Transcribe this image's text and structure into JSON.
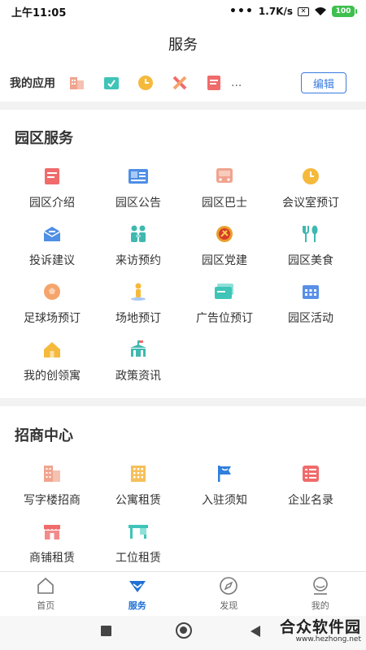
{
  "status_bar": {
    "time": "上午11:05",
    "dots": "•••",
    "speed": "1.7K/s",
    "battery": "100"
  },
  "header": {
    "title": "服务"
  },
  "my_apps": {
    "label": "我的应用",
    "icons": [
      "building-icon",
      "check-icon",
      "clock-icon",
      "tools-icon",
      "note-icon"
    ],
    "more": "...",
    "edit_label": "编辑"
  },
  "park_services": {
    "title": "园区服务",
    "items": [
      {
        "label": "园区介绍",
        "icon": "intro-icon",
        "color": "#f06b6b"
      },
      {
        "label": "园区公告",
        "icon": "notice-icon",
        "color": "#4f8fe6"
      },
      {
        "label": "园区巴士",
        "icon": "bus-icon",
        "color": "#f0a48f"
      },
      {
        "label": "会议室预订",
        "icon": "meeting-clock-icon",
        "color": "#f5b93b"
      },
      {
        "label": "投诉建议",
        "icon": "mail-icon",
        "color": "#4f8fe6"
      },
      {
        "label": "来访预约",
        "icon": "visitors-icon",
        "color": "#3fb8b0"
      },
      {
        "label": "园区党建",
        "icon": "party-icon",
        "color": "#e8a12c"
      },
      {
        "label": "园区美食",
        "icon": "food-icon",
        "color": "#3fb8b0"
      },
      {
        "label": "足球场预订",
        "icon": "football-icon",
        "color": "#f5a56b"
      },
      {
        "label": "场地预订",
        "icon": "venue-icon",
        "color": "#f5b93b"
      },
      {
        "label": "广告位预订",
        "icon": "ad-card-icon",
        "color": "#3fc4b8"
      },
      {
        "label": "园区活动",
        "icon": "calendar-icon",
        "color": "#5a8fe8"
      },
      {
        "label": "我的创领寓",
        "icon": "house-icon",
        "color": "#f5b93b"
      },
      {
        "label": "政策资讯",
        "icon": "policy-icon",
        "color": "#3fb8b0"
      }
    ]
  },
  "investment_center": {
    "title": "招商中心",
    "items": [
      {
        "label": "写字楼招商",
        "icon": "office-building-icon",
        "color": "#f0a48f"
      },
      {
        "label": "公寓租赁",
        "icon": "apartment-icon",
        "color": "#f5c05a"
      },
      {
        "label": "入驻须知",
        "icon": "flag-icon",
        "color": "#2f7fdc"
      },
      {
        "label": "企业名录",
        "icon": "directory-icon",
        "color": "#f06b6b"
      },
      {
        "label": "商铺租赁",
        "icon": "shop-icon",
        "color": "#f06b6b"
      },
      {
        "label": "工位租赁",
        "icon": "desk-icon",
        "color": "#3fc4b8"
      }
    ]
  },
  "tabbar": {
    "items": [
      {
        "label": "首页",
        "icon": "home-icon",
        "active": false
      },
      {
        "label": "服务",
        "icon": "service-icon",
        "active": true
      },
      {
        "label": "发现",
        "icon": "compass-icon",
        "active": false
      },
      {
        "label": "我的",
        "icon": "profile-icon",
        "active": false
      }
    ]
  },
  "watermark": {
    "name": "合众软件园",
    "url": "www.hezhong.net"
  },
  "colors": {
    "accent": "#1f6fd6",
    "edit": "#3a7be0",
    "divider": "#f2f2f2"
  }
}
